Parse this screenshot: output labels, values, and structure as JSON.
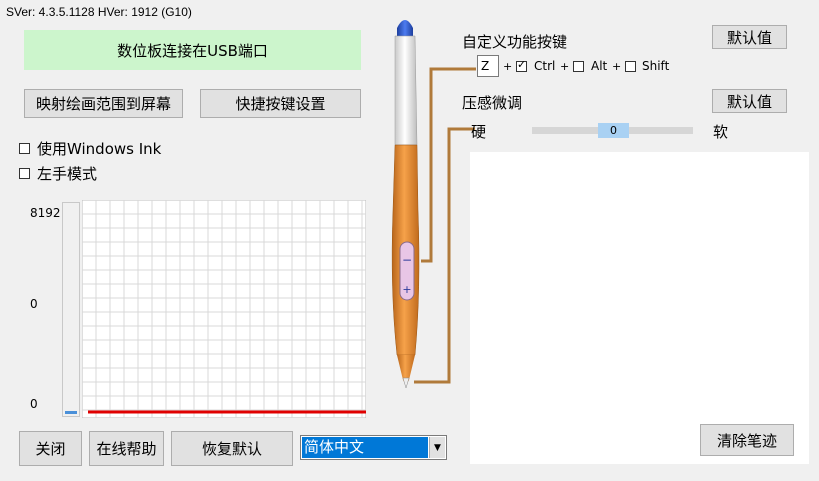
{
  "version": {
    "text": "SVer: 4.3.5.1128  HVer: 1912  (G10)"
  },
  "status_banner": "数位板连接在USB端口",
  "buttons": {
    "map_screen": "映射绘画范围到屏幕",
    "shortcut_settings": "快捷按键设置",
    "close": "关闭",
    "online_help": "在线帮助",
    "restore_default": "恢复默认",
    "default_value_1": "默认值",
    "default_value_2": "默认值",
    "clear_strokes": "清除笔迹"
  },
  "options": {
    "windows_ink": {
      "label": "使用Windows Ink",
      "checked": false
    },
    "left_hand": {
      "label": "左手模式",
      "checked": false
    }
  },
  "pressure_chart": {
    "y_labels": [
      "8192",
      "0",
      "0"
    ],
    "bar_color": "#4a90d9",
    "baseline_color": "#e00000"
  },
  "language_select": {
    "selected": "简体中文"
  },
  "custom_key": {
    "title": "自定义功能按键",
    "key_value": "Z",
    "plus": "+",
    "ctrl": {
      "label": "Ctrl",
      "checked": true
    },
    "alt": {
      "label": "Alt",
      "checked": false
    },
    "shift": {
      "label": "Shift",
      "checked": false
    }
  },
  "pressure_tune": {
    "title": "压感微调",
    "hard_label": "硬",
    "soft_label": "软",
    "value": "0"
  },
  "colors": {
    "banner_bg": "#ccf5cc",
    "pen_orange": "#e8852a",
    "connector": "#b07a3a"
  }
}
